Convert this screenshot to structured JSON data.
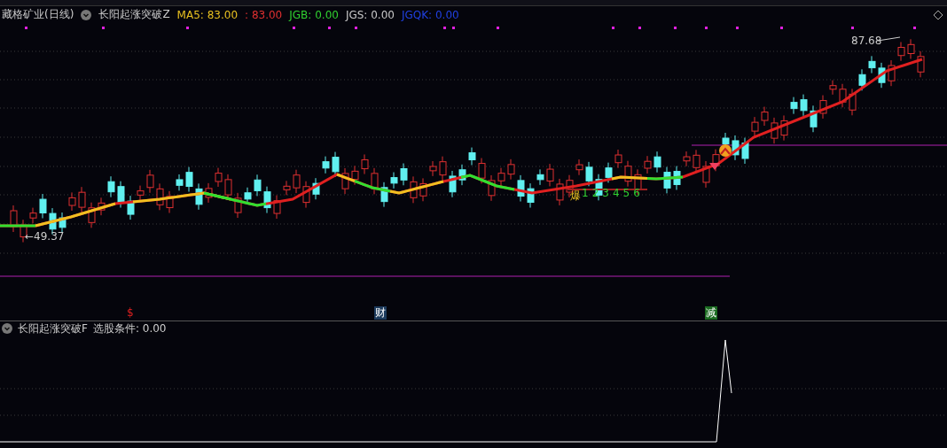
{
  "header": {
    "stock": "藏格矿业(日线)",
    "indicator": "长阳起涨突破Z",
    "readouts": [
      {
        "text": "MA5: 83.00",
        "color": "#e8c020"
      },
      {
        "text": ": 83.00",
        "color": "#e03030"
      },
      {
        "text": "JGB: 0.00",
        "color": "#30d030"
      },
      {
        "text": "JGS: 0.00",
        "color": "#c8c8c8"
      },
      {
        "text": "JGQK: 0.00",
        "color": "#2040e0"
      }
    ]
  },
  "main_chart": {
    "high_label": "87.68",
    "low_label": "←49.37",
    "signal_label": "爆",
    "count_labels": [
      "1",
      "2",
      "3",
      "4",
      "5",
      "6"
    ]
  },
  "event_markers": [
    {
      "text": "$",
      "kind": "dividend",
      "color": "#e02020"
    },
    {
      "text": "财",
      "kind": "report",
      "color": "#1c3a5c"
    },
    {
      "text": "减",
      "kind": "reduce",
      "color": "#1a6a20"
    }
  ],
  "sub_panel": {
    "indicator": "长阳起涨突破F",
    "readout": "选股条件: 0.00"
  }
}
